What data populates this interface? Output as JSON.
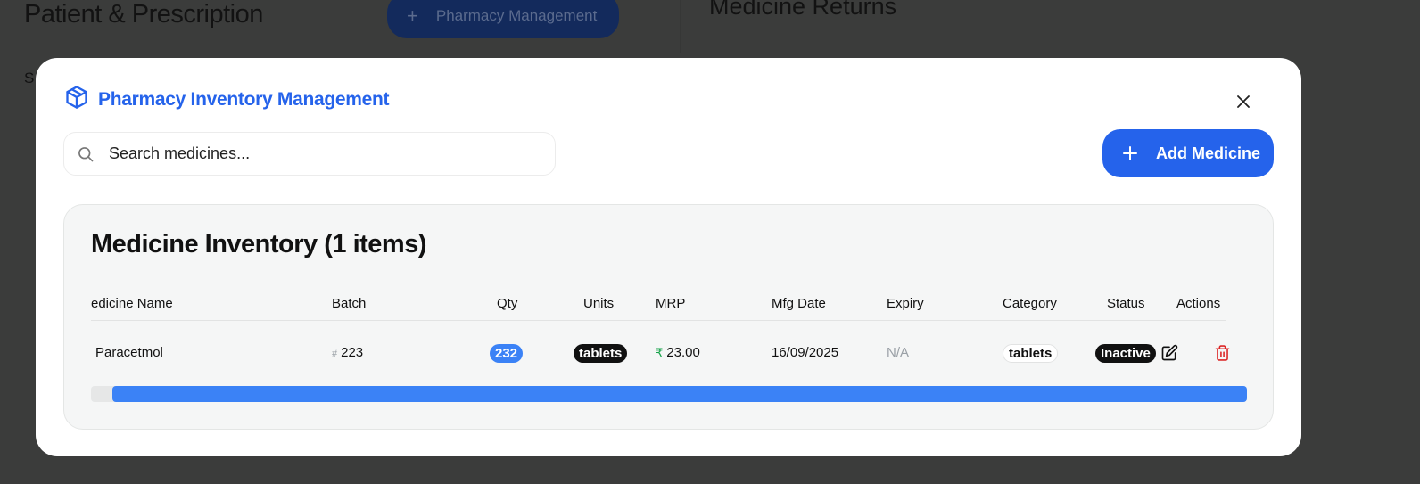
{
  "background": {
    "left_title": "Patient & Prescription",
    "pharmacy_button": "Pharmacy Management",
    "right_title": "Medicine Returns",
    "left_truncated": "S"
  },
  "modal": {
    "title": "Pharmacy Inventory Management",
    "search": {
      "placeholder": "Search medicines..."
    },
    "add_button": "Add Medicine",
    "inventory": {
      "title": "Medicine Inventory (1 items)",
      "columns": [
        "edicine Name",
        "Batch",
        "Qty",
        "Units",
        "MRP",
        "Mfg Date",
        "Expiry",
        "Category",
        "Status",
        "Actions"
      ],
      "rows": [
        {
          "name": "Paracetmol",
          "batch": "223",
          "qty": "232",
          "units": "tablets",
          "mrp": "23.00",
          "mfg_date": "16/09/2025",
          "expiry": "N/A",
          "category": "tablets",
          "status": "Inactive"
        }
      ],
      "scroll_position": 0.02
    }
  },
  "colors": {
    "accent": "#2563eb",
    "qty_badge": "#3b82f6",
    "delete": "#dc2626",
    "rupee": "#16a34a"
  },
  "icons": {
    "header": "package-icon",
    "close": "close-icon",
    "search": "search-icon",
    "add": "plus-icon",
    "edit": "edit-icon",
    "delete": "trash-icon"
  }
}
